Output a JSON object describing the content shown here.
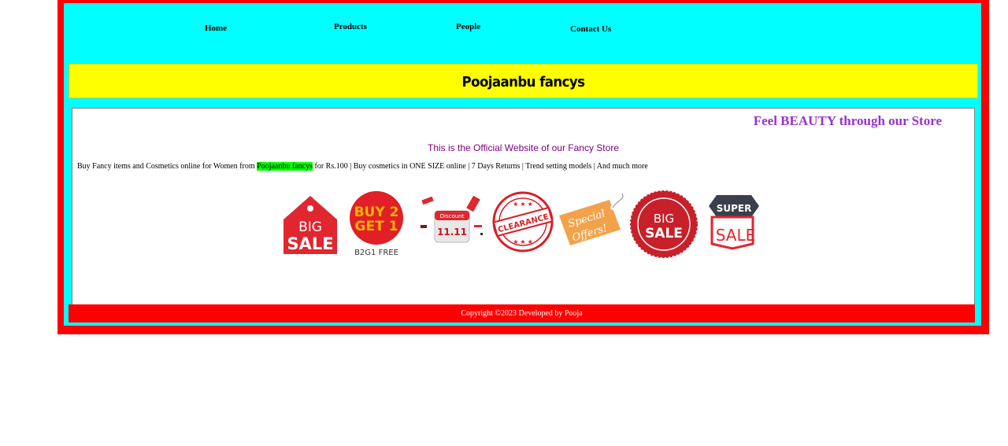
{
  "nav": {
    "items": [
      {
        "label": "Home"
      },
      {
        "label": "Products"
      },
      {
        "label": "People"
      },
      {
        "label": "Contact Us"
      }
    ]
  },
  "header": {
    "title": "Poojaanbu fancys"
  },
  "main": {
    "marquee": "Feel BEAUTY through our Store",
    "official": "This is the Official Website of our Fancy Store",
    "desc_before": "Buy Fancy items and Cosmetics online for Women from ",
    "desc_highlight": "Poojaanbu fancys",
    "desc_after": " for Rs.100 | Buy cosmetics in ONE SIZE online | 7 Days Returns | Trend setting models | And much more"
  },
  "offers": {
    "big_sale_1_line1": "BIG",
    "big_sale_1_line2": "SALE",
    "buy2_line1": "BUY 2",
    "buy2_line2": "GET 1",
    "buy2_caption": "B2G1 FREE",
    "discount_label": "Discount",
    "discount_date": "11.11",
    "clearance": "CLEARANCE",
    "special_line1": "Special",
    "special_line2": "Offers!",
    "big_sale_2_line1": "BIG",
    "big_sale_2_line2": "SALE",
    "super_line1": "SUPER",
    "super_line2": "SALE"
  },
  "footer": {
    "copyright": "Copyright ©2023 Developed by Pooja"
  },
  "colors": {
    "frame": "#ff0000",
    "background": "#00ffff",
    "banner": "#ffff00",
    "marquee_text": "#9932cc",
    "official_text": "#800080",
    "highlight": "#00ff00"
  }
}
